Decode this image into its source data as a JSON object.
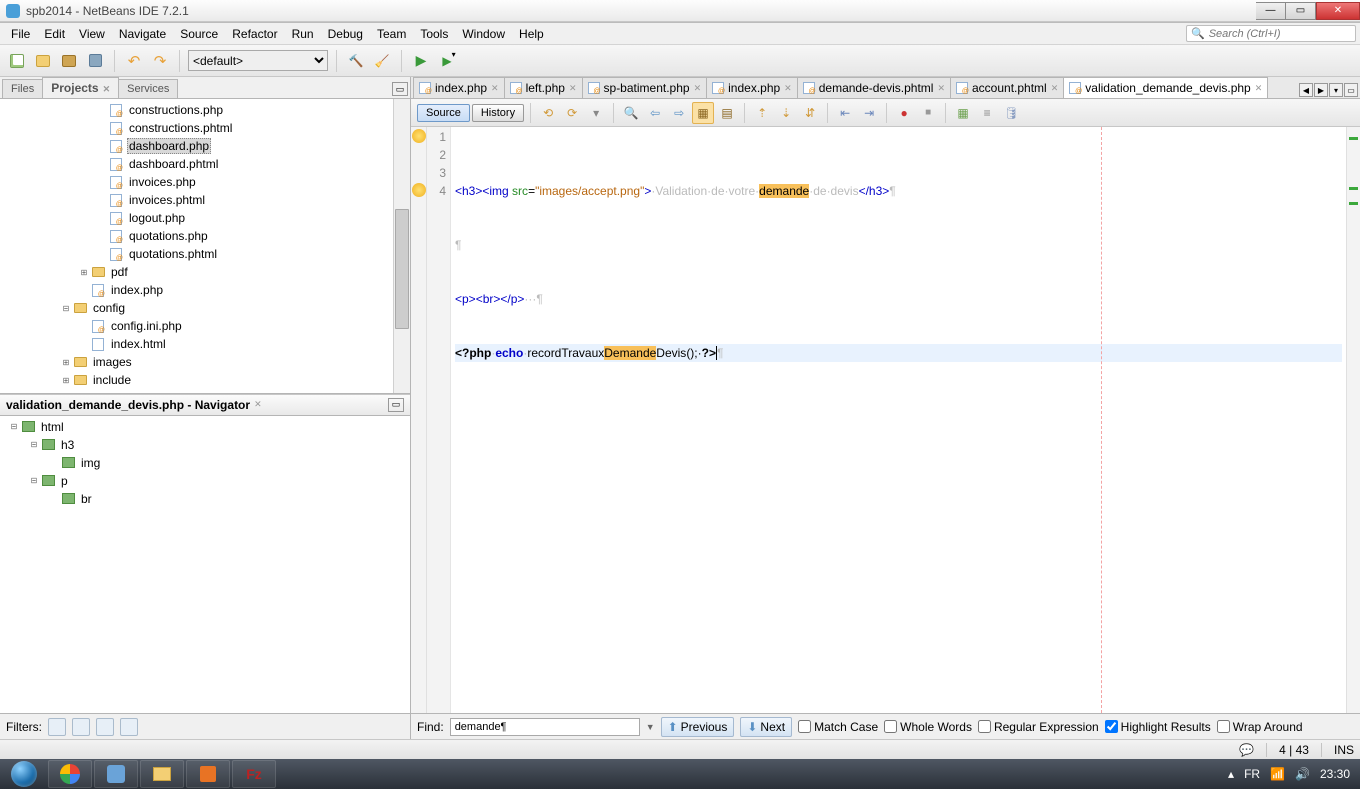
{
  "window": {
    "title": "spb2014 - NetBeans IDE 7.2.1"
  },
  "menu": [
    "File",
    "Edit",
    "View",
    "Navigate",
    "Source",
    "Refactor",
    "Run",
    "Debug",
    "Team",
    "Tools",
    "Window",
    "Help"
  ],
  "search_placeholder": "Search (Ctrl+I)",
  "config_dropdown": "<default>",
  "left_tabs": {
    "files": "Files",
    "projects": "Projects",
    "services": "Services"
  },
  "project_tree": [
    {
      "ind": "ind3",
      "icon": "php",
      "label": "constructions.php"
    },
    {
      "ind": "ind3",
      "icon": "php",
      "label": "constructions.phtml"
    },
    {
      "ind": "ind3",
      "icon": "php",
      "label": "dashboard.php",
      "sel": true
    },
    {
      "ind": "ind3",
      "icon": "php",
      "label": "dashboard.phtml"
    },
    {
      "ind": "ind3",
      "icon": "php",
      "label": "invoices.php"
    },
    {
      "ind": "ind3",
      "icon": "php",
      "label": "invoices.phtml"
    },
    {
      "ind": "ind3",
      "icon": "php",
      "label": "logout.php"
    },
    {
      "ind": "ind3",
      "icon": "php",
      "label": "quotations.php"
    },
    {
      "ind": "ind3",
      "icon": "php",
      "label": "quotations.phtml"
    },
    {
      "ind": "ind2",
      "icon": "folder",
      "label": "pdf",
      "tw": "+"
    },
    {
      "ind": "ind2",
      "icon": "php",
      "label": "index.php"
    },
    {
      "ind": "ind1",
      "icon": "folder",
      "label": "config",
      "tw": "-"
    },
    {
      "ind": "ind2",
      "icon": "php",
      "label": "config.ini.php"
    },
    {
      "ind": "ind2",
      "icon": "html",
      "label": "index.html"
    },
    {
      "ind": "ind1",
      "icon": "folder",
      "label": "images",
      "tw": "+"
    },
    {
      "ind": "ind1",
      "icon": "folder",
      "label": "include",
      "tw": "+"
    }
  ],
  "navigator": {
    "title": "validation_demande_devis.php - Navigator",
    "nodes": [
      {
        "ind": "indA",
        "label": "html",
        "tw": "-"
      },
      {
        "ind": "indB",
        "label": "h3",
        "tw": "-"
      },
      {
        "ind": "ind3",
        "label": "img",
        "tw": ""
      },
      {
        "ind": "indB",
        "label": "p",
        "tw": "-"
      },
      {
        "ind": "ind3",
        "label": "br",
        "tw": ""
      }
    ]
  },
  "filters_label": "Filters:",
  "editor_tabs": [
    {
      "label": "index.php"
    },
    {
      "label": "left.php"
    },
    {
      "label": "sp-batiment.php"
    },
    {
      "label": "index.php"
    },
    {
      "label": "demande-devis.phtml"
    },
    {
      "label": "account.phtml"
    },
    {
      "label": "validation_demande_devis.php",
      "active": true
    }
  ],
  "editor_toolbar": {
    "source": "Source",
    "history": "History"
  },
  "code": {
    "lines": [
      "1",
      "2",
      "3",
      "4"
    ],
    "l1": {
      "a": "<h3><img",
      "src_attr": " src",
      "eq": "=",
      "val": "\"images/accept.png\"",
      "b": ">",
      "t1": "·Validation·de·votre·",
      "hl": "demande",
      "t2": "·de·devis",
      "c": "</h3>",
      "eol": "¶"
    },
    "l2": "¶",
    "l3": {
      "a": "<p><br></p>",
      "b": "···¶"
    },
    "l4": {
      "a": "<?php",
      "sp": "·",
      "kw": "echo",
      "sp2": "·",
      "fn": "recordTravaux",
      "hl": "Demande",
      "fn2": "Devis",
      "rest": "();·",
      "c": "?>",
      "eol": "¶"
    }
  },
  "find": {
    "label": "Find:",
    "value": "demande¶",
    "prev": "Previous",
    "next": "Next",
    "match": "Match Case",
    "whole": "Whole Words",
    "regex": "Regular Expression",
    "highlight": "Highlight Results",
    "wrap": "Wrap Around"
  },
  "status": {
    "pos": "4 | 43",
    "ins": "INS",
    "kb": "FR",
    "time": "23:30"
  }
}
